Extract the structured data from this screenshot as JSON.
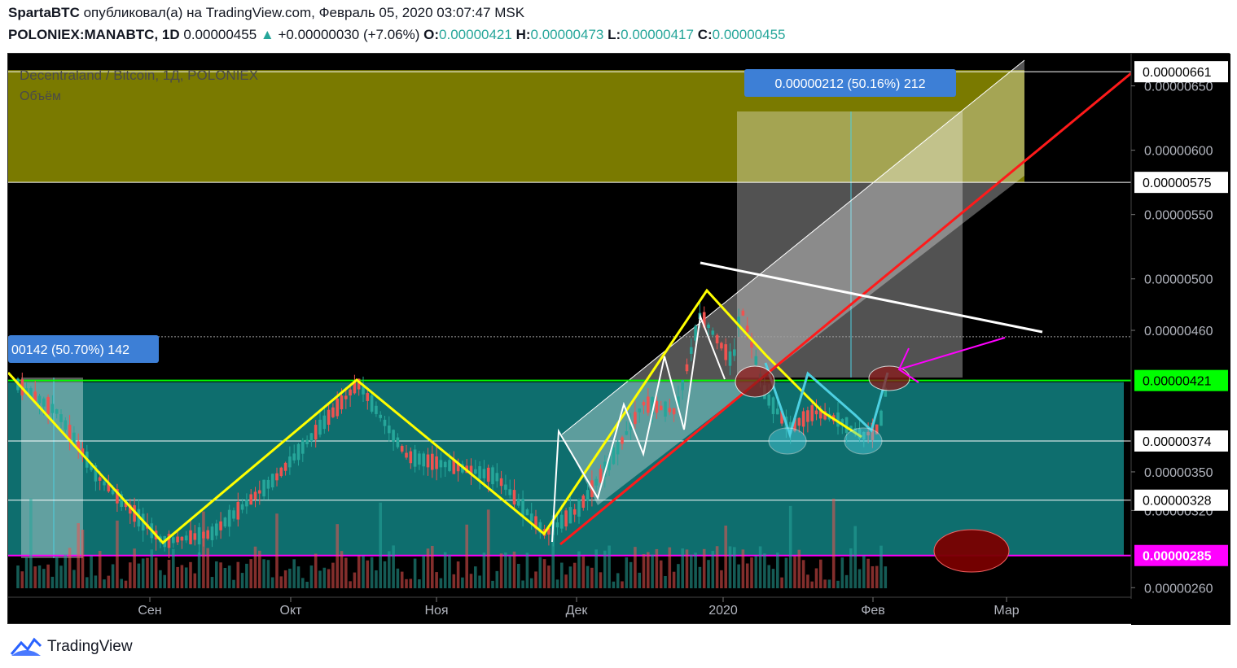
{
  "header": {
    "author": "SpartaBTC",
    "published_text": "опубликовал(а) на TradingView.com, Февраль 05, 2020 03:07:47 MSK",
    "symbol": "POLONIEX:MANABTC, 1D",
    "last_price": "0.00000455",
    "arrow": "▲",
    "change": "+0.00000030 (+7.06%)",
    "open_label": "O:",
    "open": "0.00000421",
    "high_label": "H:",
    "high": "0.00000473",
    "low_label": "L:",
    "low": "0.00000417",
    "close_label": "C:",
    "close": "0.00000455"
  },
  "footer": {
    "brand": "TradingView"
  },
  "chart_data": {
    "type": "candlestick",
    "title": "Decentraland / Bitcoin, 1Д, POLONIEX",
    "volume_label": "Объём",
    "x_ticks": [
      "Сен",
      "Окт",
      "Ноя",
      "Дек",
      "2020",
      "Фев",
      "Мар"
    ],
    "y_ticks": [
      "0.00000650",
      "0.00000600",
      "0.00000550",
      "0.00000500",
      "0.00000460",
      "0.00000350",
      "0.00000320",
      "0.00000260"
    ],
    "ylim": [
      2.45e-06,
      6.75e-06
    ],
    "price_levels": [
      {
        "value": 6.61e-06,
        "label": "0.00000661",
        "color": "#ffffff"
      },
      {
        "value": 5.75e-06,
        "label": "0.00000575",
        "color": "#ffffff"
      },
      {
        "value": 4.21e-06,
        "label": "0.00000421",
        "color": "#00ff00"
      },
      {
        "value": 3.74e-06,
        "label": "0.00000374",
        "color": "#ffffff"
      },
      {
        "value": 3.28e-06,
        "label": "0.00000328",
        "color": "#ffffff"
      },
      {
        "value": 2.85e-06,
        "label": "0.00000285",
        "color": "#ff00ff"
      }
    ],
    "measure_labels": [
      {
        "text": "0.00000212 (50.16%) 212",
        "color": "#3d7fd6"
      },
      {
        "text": "00142 (50.70%) 142",
        "color": "#3d7fd6"
      }
    ],
    "colors": {
      "up": "#26a69a",
      "down": "#ef5350",
      "background": "#000000",
      "support_zone": "#0e6e6e",
      "resistance_zone": "#7a7a00",
      "pattern": "#ffff00",
      "trend": "#ff1a1a",
      "target": "#ff00ff"
    }
  }
}
